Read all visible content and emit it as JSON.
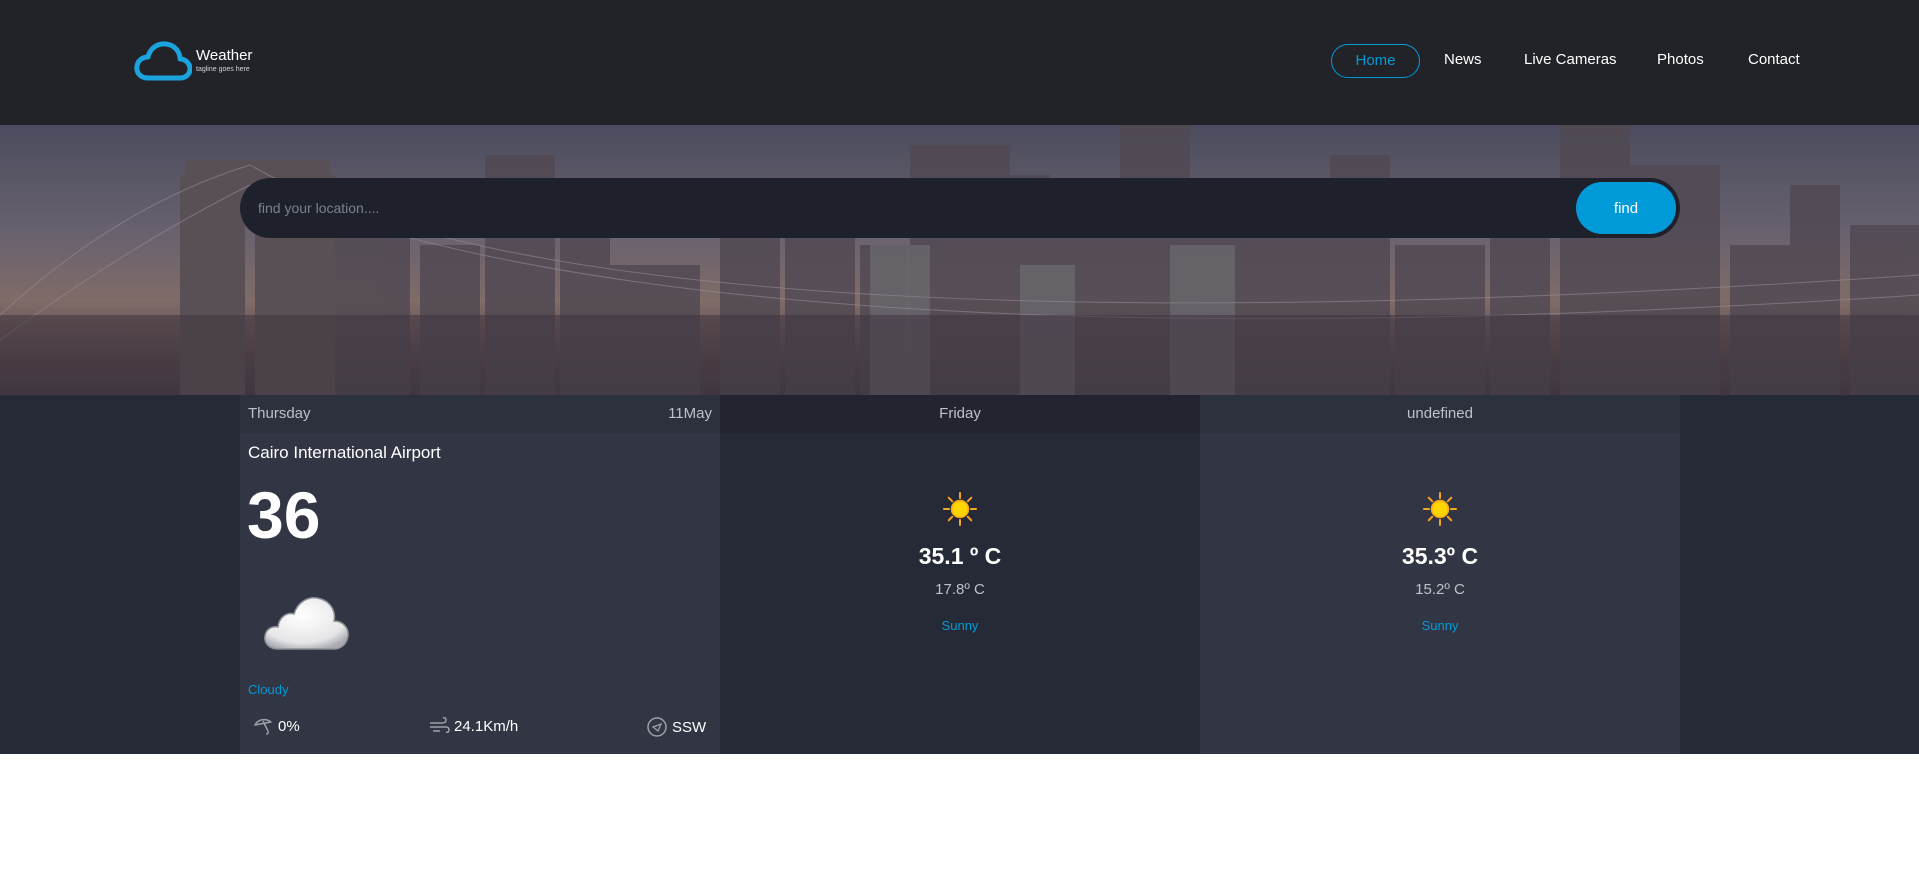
{
  "brand": {
    "title": "Weather",
    "tagline": "tagline goes here",
    "accent_color": "#009ad8"
  },
  "nav": {
    "items": [
      {
        "label": "Home",
        "active": true
      },
      {
        "label": "News",
        "active": false
      },
      {
        "label": "Live Cameras",
        "active": false
      },
      {
        "label": "Photos",
        "active": false
      },
      {
        "label": "Contact",
        "active": false
      }
    ]
  },
  "search": {
    "placeholder": "find your location....",
    "button_label": "find"
  },
  "today": {
    "day": "Thursday",
    "date": "11May",
    "location": "Cairo International Airport",
    "temperature": "36",
    "icon": "cloud-icon",
    "condition": "Cloudy",
    "stats": {
      "rain": "0%",
      "wind_speed": "24.1Km/h",
      "wind_direction": "SSW"
    }
  },
  "forecast": [
    {
      "day": "Friday",
      "icon": "sun-icon",
      "max_temp": "35.1 º C",
      "min_temp": "17.8º C",
      "condition": "Sunny"
    },
    {
      "day": "undefined",
      "icon": "sun-icon",
      "max_temp": "35.3º C",
      "min_temp": "15.2º C",
      "condition": "Sunny"
    }
  ]
}
